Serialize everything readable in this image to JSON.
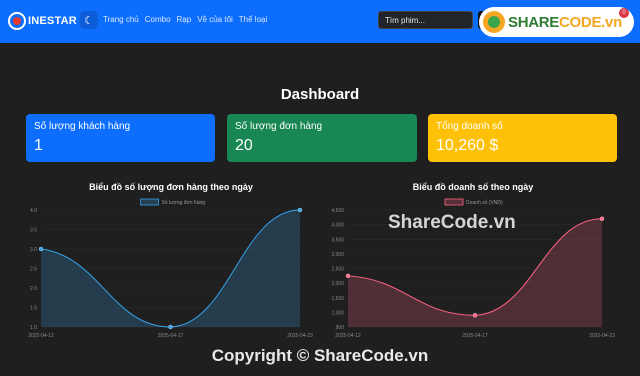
{
  "nav": {
    "brand": "INESTAR",
    "theme_icon": "☾",
    "links": [
      "Trang chủ",
      "Combo",
      "Rạp",
      "Về của tôi",
      "Thể loại"
    ],
    "search_placeholder": "Tìm phim...",
    "notification_count": "0"
  },
  "watermark": {
    "logo_prefix": "SHARE",
    "logo_suffix": "CODE.vn",
    "overlay": "ShareCode.vn",
    "copyright": "Copyright © ShareCode.vn"
  },
  "page": {
    "title": "Dashboard"
  },
  "cards": [
    {
      "label": "Số lượng khách hàng",
      "value": "1",
      "color": "#0d6efd"
    },
    {
      "label": "Số lượng đơn hàng",
      "value": "20",
      "color": "#198754"
    },
    {
      "label": "Tổng doanh số",
      "value": "10,260 $",
      "color": "#ffc107"
    }
  ],
  "chart_data": [
    {
      "type": "line",
      "title": "Biểu đồ số lượng đơn hàng theo ngày",
      "x": [
        "2025-04-12",
        "2025-04-17",
        "2025-04-23"
      ],
      "series": [
        {
          "name": "Số lượng đơn hàng",
          "values": [
            3.0,
            1.0,
            4.0
          ],
          "color": "#36a2eb"
        }
      ],
      "ylim": [
        1.0,
        4.0
      ],
      "yticks": [
        "4.0",
        "3.5",
        "3.0",
        "2.5",
        "2.0",
        "1.5",
        "1.0"
      ],
      "legend": "top",
      "fill": true
    },
    {
      "type": "line",
      "title": "Biểu đồ doanh số theo ngày",
      "x": [
        "2025-04-12",
        "2025-04-17",
        "2025-04-23"
      ],
      "series": [
        {
          "name": "Doanh số (VND)",
          "values": [
            2250,
            900,
            4200
          ],
          "color": "#ff6384"
        }
      ],
      "ylim": [
        500,
        4500
      ],
      "yticks": [
        "4,500",
        "4,000",
        "3,500",
        "3,000",
        "2,500",
        "2,000",
        "1,500",
        "1,000",
        "500"
      ],
      "legend": "top",
      "fill": true
    }
  ]
}
